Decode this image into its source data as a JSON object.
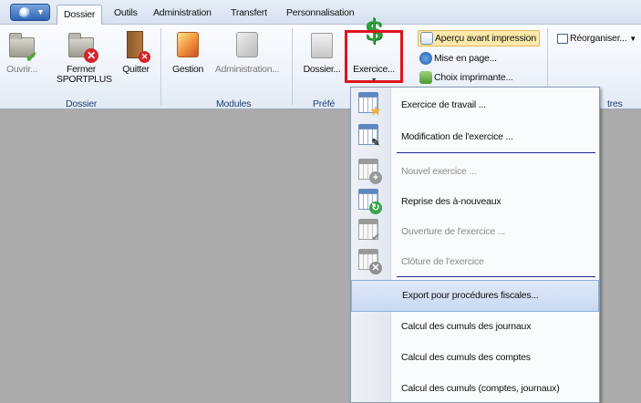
{
  "tabs": [
    "Dossier",
    "Outils",
    "Administration",
    "Transfert",
    "Personnalisation"
  ],
  "ribbon": {
    "dossier_group": {
      "label": "Dossier",
      "buttons": {
        "ouvrir": "Ouvrir...",
        "fermer_line1": "Fermer",
        "fermer_line2": "SPORTPLUS",
        "quitter": "Quitter"
      }
    },
    "modules_group": {
      "label": "Modules",
      "buttons": {
        "gestion": "Gestion",
        "administration": "Administration..."
      }
    },
    "preferences_group": {
      "label": "Préfé",
      "buttons": {
        "dossier": "Dossier...",
        "exercice": "Exercice..."
      }
    },
    "print_items": {
      "apercu": "Aperçu avant impression",
      "mise_en_page": "Mise en page...",
      "choix_imprimante": "Choix imprimante..."
    },
    "reorganiser": "Réorganiser...",
    "tres_label": "tres"
  },
  "menu": {
    "items": [
      {
        "label": "Exercice de travail ...",
        "enabled": true,
        "icon": "calendar-star-icon"
      },
      {
        "label": "Modification de l'exercice ...",
        "enabled": true,
        "icon": "calendar-edit-icon"
      },
      {
        "label": "Nouvel exercice ...",
        "enabled": false,
        "icon": "calendar-add-icon"
      },
      {
        "label": "Reprise des à-nouveaux",
        "enabled": true,
        "icon": "calendar-refresh-icon"
      },
      {
        "label": "Ouverture de l'exercice ...",
        "enabled": false,
        "icon": "calendar-check-icon"
      },
      {
        "label": "Clôture de l'exercice",
        "enabled": false,
        "icon": "calendar-close-icon"
      },
      {
        "label": "Export pour procédures fiscales...",
        "enabled": true,
        "selected": true
      },
      {
        "label": "Calcul des cumuls des journaux",
        "enabled": true
      },
      {
        "label": "Calcul des cumuls des comptes",
        "enabled": true
      },
      {
        "label": "Calcul des cumuls (comptes, journaux)",
        "enabled": true
      }
    ]
  },
  "colors": {
    "highlight_box": "#e0141c",
    "dollar": "#2aa33a",
    "workspace": "#ababab"
  }
}
